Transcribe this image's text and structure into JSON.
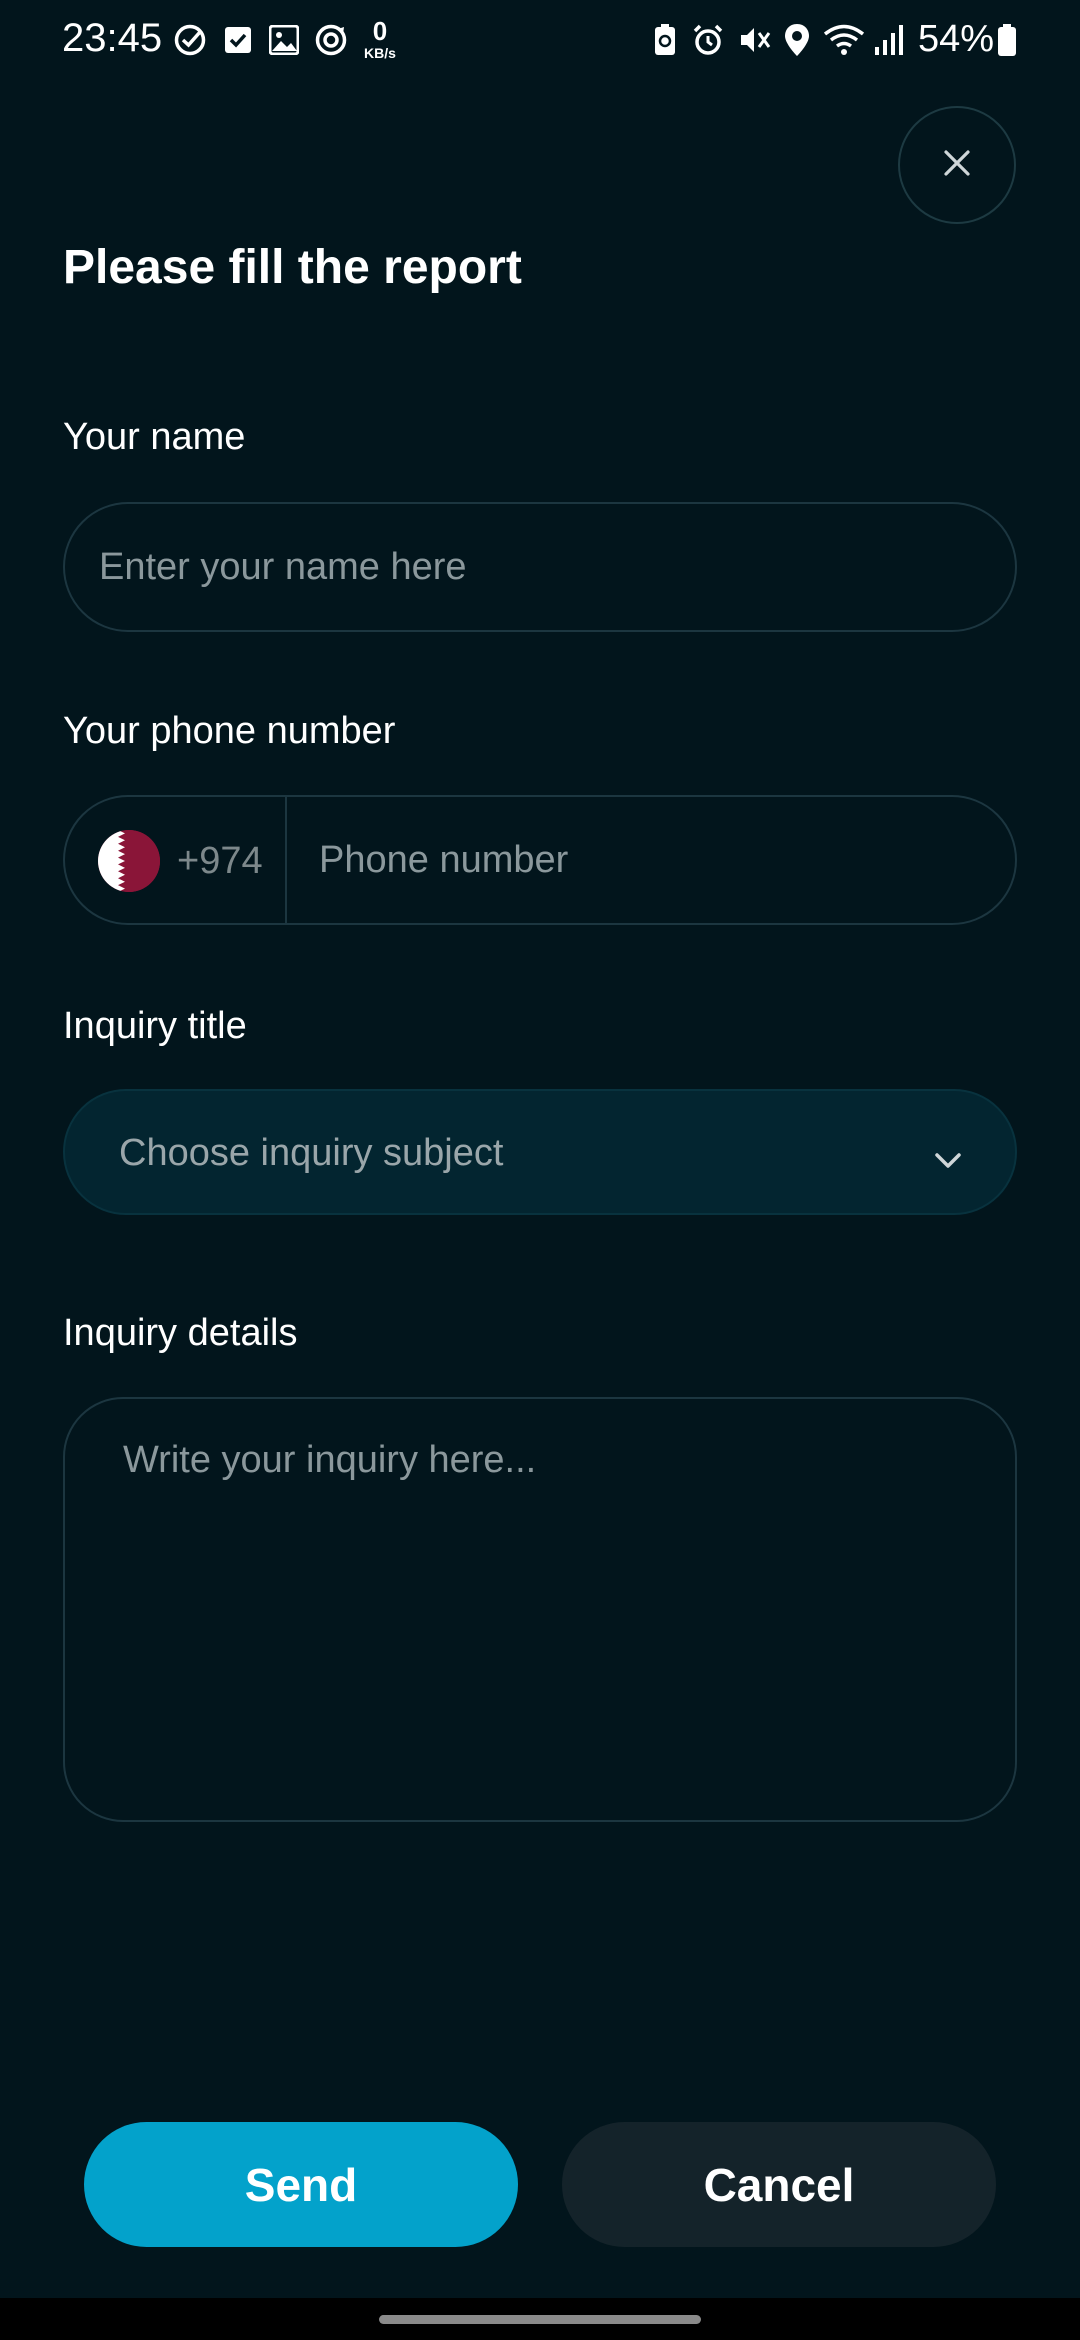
{
  "status_bar": {
    "time": "23:45",
    "net_speed_value": "0",
    "net_speed_unit": "KB/s",
    "battery_percent": "54%"
  },
  "page": {
    "title": "Please fill the report"
  },
  "form": {
    "name": {
      "label": "Your name",
      "placeholder": "Enter your name here",
      "value": ""
    },
    "phone": {
      "label": "Your phone number",
      "country_code": "+974",
      "country_flag": "qatar-flag-icon",
      "placeholder": "Phone number",
      "value": ""
    },
    "inquiry_title": {
      "label": "Inquiry title",
      "selected_text": "Choose inquiry subject"
    },
    "inquiry_details": {
      "label": "Inquiry details",
      "placeholder": "Write your inquiry here...",
      "value": ""
    }
  },
  "actions": {
    "send_label": "Send",
    "cancel_label": "Cancel"
  },
  "colors": {
    "background": "#02151c",
    "accent": "#03a2cb",
    "secondary_button": "#14232a",
    "flag_maroon": "#8a1538"
  }
}
